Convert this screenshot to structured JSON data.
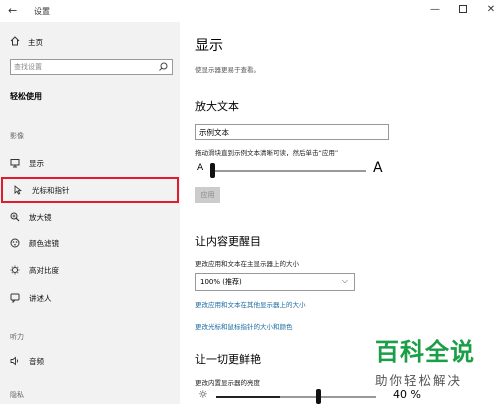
{
  "window": {
    "title": "设置",
    "back_glyph": "←",
    "min_glyph": "—",
    "close_glyph": "✕"
  },
  "sidebar": {
    "home_label": "主页",
    "search_placeholder": "查找设置",
    "section_title": "轻松使用",
    "groups": [
      {
        "label": "影像",
        "items": [
          {
            "label": "显示",
            "icon": "monitor-icon"
          },
          {
            "label": "光标和指针",
            "icon": "cursor-icon",
            "selected": true
          },
          {
            "label": "放大镜",
            "icon": "magnifier-icon"
          },
          {
            "label": "颜色滤镜",
            "icon": "color-filter-icon"
          },
          {
            "label": "高对比度",
            "icon": "contrast-icon"
          },
          {
            "label": "讲述人",
            "icon": "narrator-icon"
          }
        ]
      },
      {
        "label": "听力",
        "items": [
          {
            "label": "音频",
            "icon": "speaker-icon"
          }
        ]
      },
      {
        "label": "隐私",
        "items": []
      }
    ]
  },
  "main": {
    "title": "显示",
    "description": "使显示器更易于查看。",
    "enlarge_text": {
      "heading": "放大文本",
      "sample_text": "示例文本",
      "hint": "拖动滑块直到示例文本清晰可读，然后单击“应用”",
      "small_a": "A",
      "big_a": "A",
      "slider_value": 0.0,
      "apply_label": "应用"
    },
    "make_bigger": {
      "heading": "让内容更醒目",
      "label": "更改应用和文本在主显示器上的大小",
      "dropdown_value": "100% (推荐)",
      "link1": "更改应用和文本在其他显示器上的大小",
      "link2": "更改光标和鼠标指针的大小和颜色"
    },
    "brighter": {
      "heading": "让一切更鲜艳",
      "label": "更改内置显示器的亮度",
      "brightness_value": "40 %",
      "brightness_level": 0.4
    }
  },
  "watermark": {
    "line1": "百科全说",
    "line2": "助你轻松解决"
  },
  "colors": {
    "sidebar_bg": "#f2f2f2",
    "highlight_border": "#e11b2e",
    "link": "#1a6ba3",
    "watermark_green": "#1a9e46"
  }
}
